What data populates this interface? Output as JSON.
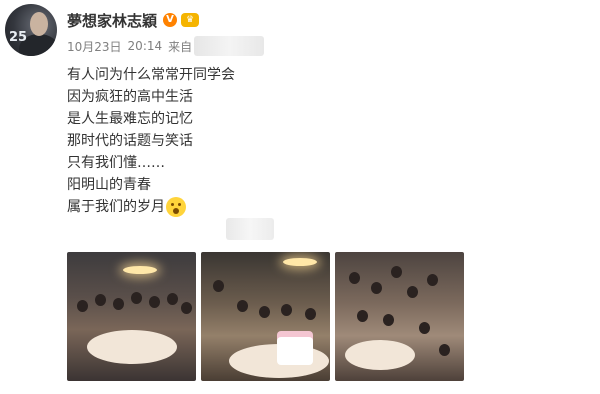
{
  "post": {
    "author_name": "夢想家林志穎",
    "verified_icon": "verified-v-icon",
    "member_icon": "crown-member-icon",
    "avatar_badge": "25",
    "date": "10月23日",
    "time": "20:14",
    "source_prefix": "来自",
    "lines": [
      "有人问为什么常常开同学会",
      "因为疯狂的高中生活",
      "是人生最难忘的记忆",
      "那时代的话题与笑话",
      "只有我们懂……",
      "阳明山的青春",
      "属于我们的岁月"
    ],
    "emoji_icon": "crying-face-emoji",
    "photos": [
      "group-photo-1",
      "group-photo-2",
      "group-photo-3"
    ]
  },
  "colors": {
    "author": "#333333",
    "meta": "#808080",
    "verified": "#ff8200"
  }
}
